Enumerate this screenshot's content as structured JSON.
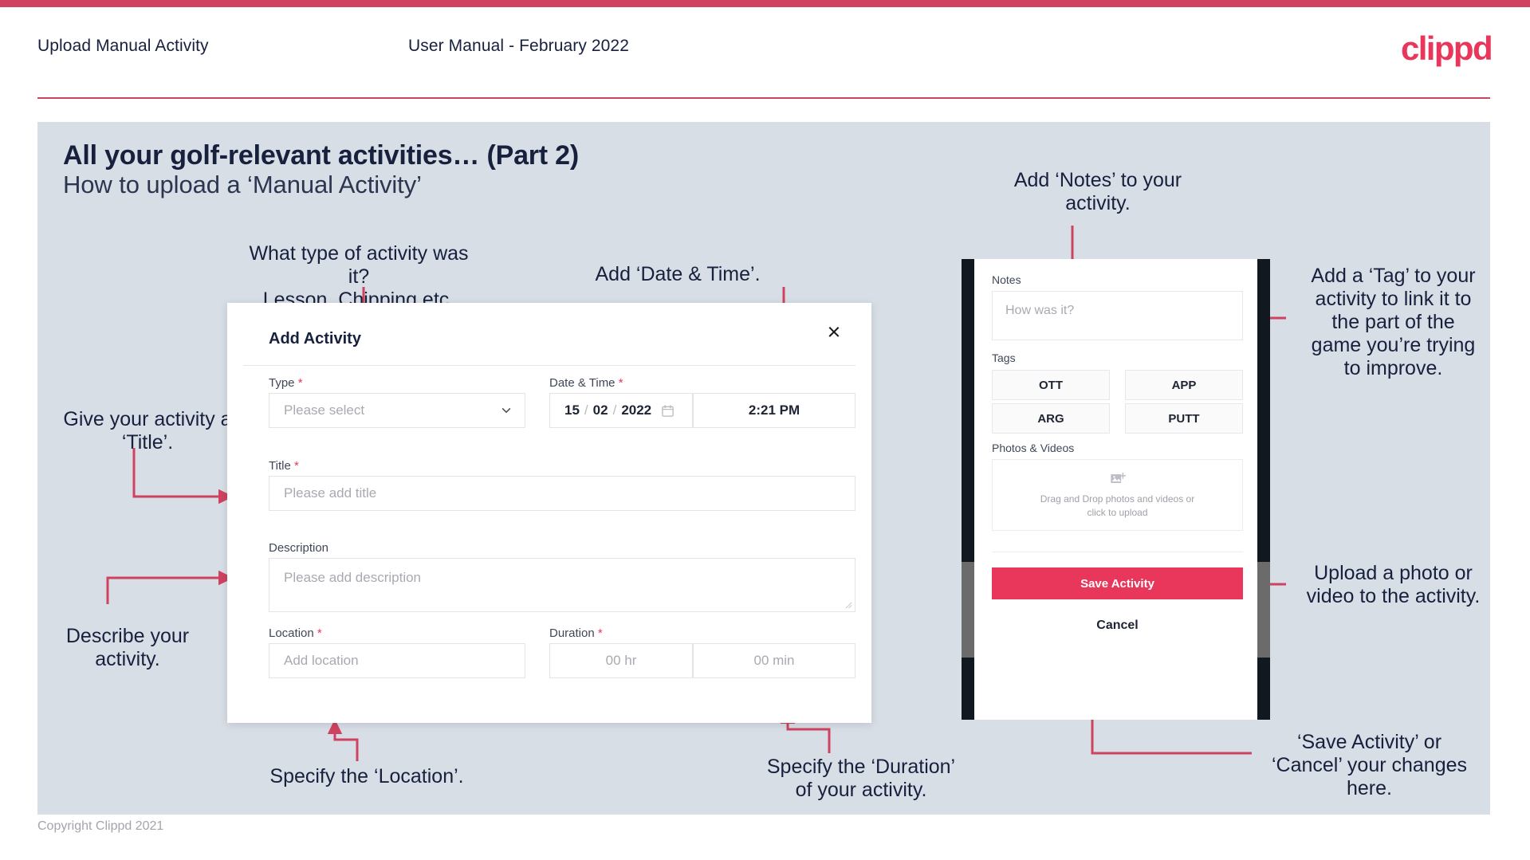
{
  "header": {
    "title": "Upload Manual Activity",
    "subtitle": "User Manual - February 2022",
    "logo": "clippd",
    "accent_color": "#cf4360",
    "brand_color": "#e8375a"
  },
  "slide": {
    "title": "All your golf-relevant activities… (Part 2)",
    "subtitle": "How to upload a ‘Manual Activity’",
    "background_color": "#d8dee6"
  },
  "callouts": {
    "type": "What type of activity was it?\nLesson, Chipping etc.",
    "date_time": "Add ‘Date & Time’.",
    "title": "Give your activity a\n‘Title’.",
    "description": "Describe your\nactivity.",
    "location": "Specify the ‘Location’.",
    "duration": "Specify the ‘Duration’\nof your activity.",
    "notes": "Add ‘Notes’ to your\nactivity.",
    "tags": "Add a ‘Tag’ to your\nactivity to link it to\nthe part of the\ngame you’re trying\nto improve.",
    "photos": "Upload a photo or\nvideo to the activity.",
    "save_cancel": "‘Save Activity’ or\n‘Cancel’ your changes\nhere."
  },
  "dialog": {
    "title": "Add Activity",
    "close_label": "×",
    "fields": {
      "type": {
        "label": "Type",
        "required": "*",
        "placeholder": "Please select"
      },
      "datetime": {
        "label": "Date & Time",
        "required": "*",
        "day": "15",
        "month": "02",
        "year": "2022",
        "separator": "/",
        "time": "2:21 PM"
      },
      "title": {
        "label": "Title",
        "required": "*",
        "placeholder": "Please add title"
      },
      "description": {
        "label": "Description",
        "required": "",
        "placeholder": "Please add description"
      },
      "location": {
        "label": "Location",
        "required": "*",
        "placeholder": "Add location"
      },
      "duration": {
        "label": "Duration",
        "required": "*",
        "hours_placeholder": "00 hr",
        "minutes_placeholder": "00 min"
      }
    }
  },
  "phone": {
    "notes": {
      "label": "Notes",
      "placeholder": "How was it?"
    },
    "tags": {
      "label": "Tags",
      "items": [
        "OTT",
        "APP",
        "ARG",
        "PUTT"
      ]
    },
    "photos": {
      "label": "Photos & Videos",
      "dropzone_line1": "Drag and Drop photos and videos or",
      "dropzone_line2": "click to upload"
    },
    "save_label": "Save Activity",
    "cancel_label": "Cancel"
  },
  "footer": {
    "copyright": "Copyright Clippd 2021"
  }
}
